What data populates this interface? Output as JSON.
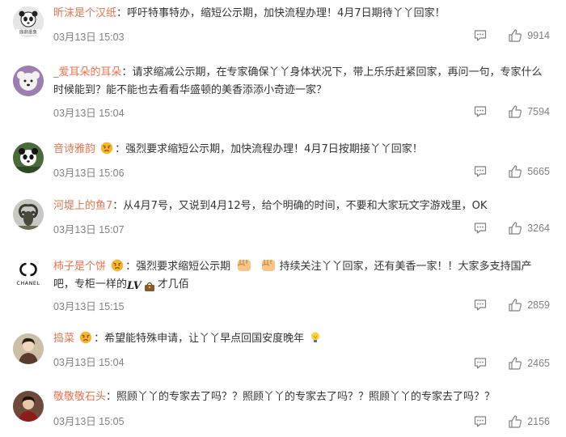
{
  "comments": [
    {
      "username": "昕沫是个汉纸",
      "separator": "：",
      "text_parts": [
        "呼吁特事特办，缩短公示期，加快流程办理！4月7日期待丫丫回家！"
      ],
      "time": "03月13日 15:03",
      "likes": "9914",
      "avatar_icon": "panda-avatar",
      "avatar_caption": "鼎鼎墨象"
    },
    {
      "username": "_爱耳朵的耳朵",
      "separator": "：",
      "text_parts": [
        "请求缩减公示期，在专家确保丫丫身体状况下，带上乐乐赶紧回家，再问一句，专家什么时候能到？能不能也去看看华盛顿的美香添添小奇迹一家？"
      ],
      "time": "03月13日 15:04",
      "likes": "7594",
      "avatar_icon": "white-dog-avatar"
    },
    {
      "username": "音诗雅韵",
      "separator": "：",
      "text_parts": [
        "强烈要求缩短公示期，加快流程办理！4月7日按期接丫丫回家！"
      ],
      "time": "03月13日 15:06",
      "likes": "5665",
      "avatar_icon": "panda-avatar",
      "badge_icon": "angry-face-emoji"
    },
    {
      "username": "河堤上的鱼7",
      "separator": "：",
      "text_parts": [
        "从4月7号，又说到4月12号，给个明确的时间，不要和大家玩文字游戏里，OK"
      ],
      "time": "03月13日 15:07",
      "likes": "3264",
      "avatar_icon": "ram-avatar"
    },
    {
      "username": "柿子是个饼",
      "separator": "：",
      "text_parts": [
        "强烈要求缩短公示期",
        "持续关注丫丫回家，还有美香一家！！大家多支持国产吧，专柜一样的",
        "LV",
        "才几佰"
      ],
      "time": "03月13日 15:15",
      "likes": "2859",
      "avatar_icon": "chanel-logo-avatar",
      "avatar_caption": "CHANEL",
      "badge_icon": "angry-face-emoji"
    },
    {
      "username": "捣菜",
      "separator": "：",
      "text_parts": [
        "希望能特殊申请，让丫丫早点回国安度晚年"
      ],
      "time": "03月13日 15:04",
      "likes": "2465",
      "avatar_icon": "portrait-avatar",
      "badge_icon": "angry-face-emoji"
    },
    {
      "username": "敬敬敬石头",
      "separator": "：",
      "text_parts": [
        "照顾丫丫的专家去了吗？？照顾丫丫的专家去了吗？？照顾丫丫的专家去了吗？？"
      ],
      "time": "03月13日 15:05",
      "likes": "2156",
      "avatar_icon": "portrait-avatar"
    }
  ],
  "colors": {
    "username": "#eb7350",
    "meta": "#808080",
    "text": "#333333"
  }
}
